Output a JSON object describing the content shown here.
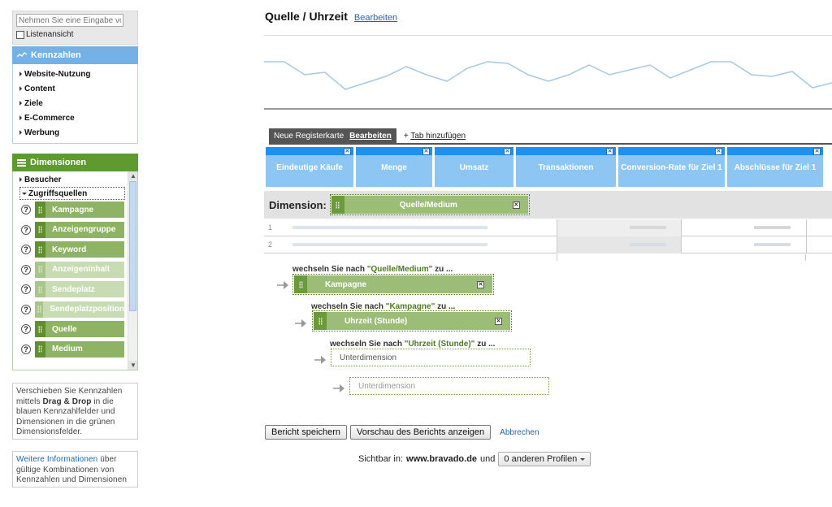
{
  "sidebar": {
    "search_placeholder": "Nehmen Sie eine Eingabe vor",
    "list_view_label": "Listenansicht",
    "metrics_panel": {
      "title": "Kennzahlen",
      "items": [
        "Website-Nutzung",
        "Content",
        "Ziele",
        "E-Commerce",
        "Werbung"
      ]
    },
    "dimensions_panel": {
      "title": "Dimensionen",
      "groups": [
        "Besucher",
        "Zugriffsquellen"
      ],
      "items": [
        {
          "label": "Kampagne",
          "state": "active"
        },
        {
          "label": "Anzeigengruppe",
          "state": "active"
        },
        {
          "label": "Keyword",
          "state": "active"
        },
        {
          "label": "Anzeigeninhalt",
          "state": "disabled"
        },
        {
          "label": "Sendeplatz",
          "state": "disabled"
        },
        {
          "label": "Sendeplatzposition",
          "state": "disabled"
        },
        {
          "label": "Quelle",
          "state": "active"
        },
        {
          "label": "Medium",
          "state": "active"
        }
      ],
      "help_glyph": "?"
    },
    "hint": {
      "part1": "Verschieben Sie Kennzahlen mittels ",
      "bold": "Drag & Drop",
      "part2": " in die blauen Kennzahlfelder und Dimensionen in die grünen Dimensionsfelder."
    },
    "more_info": {
      "link": "Weitere Informationen",
      "rest": " über gültige Kombinationen von Kennzahlen und Dimensionen"
    }
  },
  "report": {
    "title": "Quelle / Uhrzeit",
    "edit_link": "Bearbeiten",
    "tabs": {
      "active_label": "Neue Registerkarte",
      "active_edit": "Bearbeiten",
      "add_label": "+ ",
      "add_link": "Tab hinzufügen"
    },
    "metrics": [
      "Eindeutige Käufe",
      "Menge",
      "Umsatz",
      "Transaktionen",
      "Conversion-Rate für Ziel 1",
      "Abschlüsse für Ziel 1"
    ],
    "close_glyph": "✕",
    "dimension_label": "Dimension:",
    "dimension_value": "Quelle/Medium",
    "row_numbers": [
      "1",
      "2"
    ],
    "drilldown": [
      {
        "prefix": "wechseln Sie nach ",
        "quoted": "\"Quelle/Medium\"",
        "suffix": " zu ...",
        "value": "Kampagne"
      },
      {
        "prefix": "wechseln Sie nach ",
        "quoted": "\"Kampagne\"",
        "suffix": " zu ...",
        "value": "Uhrzeit (Stunde)"
      },
      {
        "prefix": "wechseln Sie nach ",
        "quoted": "\"Uhrzeit (Stunde)\"",
        "suffix": " zu ...",
        "value": "Unterdimension"
      }
    ],
    "empty_subdimension": "Unterdimension",
    "buttons": {
      "save": "Bericht speichern",
      "preview": "Vorschau des Berichts anzeigen",
      "cancel": "Abbrechen"
    },
    "visibility": {
      "prefix": "Sichtbar in:",
      "site": "www.bravado.de",
      "conj": "und",
      "profiles": "0 anderen Profilen"
    }
  },
  "colors": {
    "metric_blue": "#8ec6f3",
    "metric_header_blue": "#1f8ff0",
    "dimension_green": "#5e9a2e",
    "pill_green": "#8fb365",
    "link_blue": "#2266aa"
  }
}
